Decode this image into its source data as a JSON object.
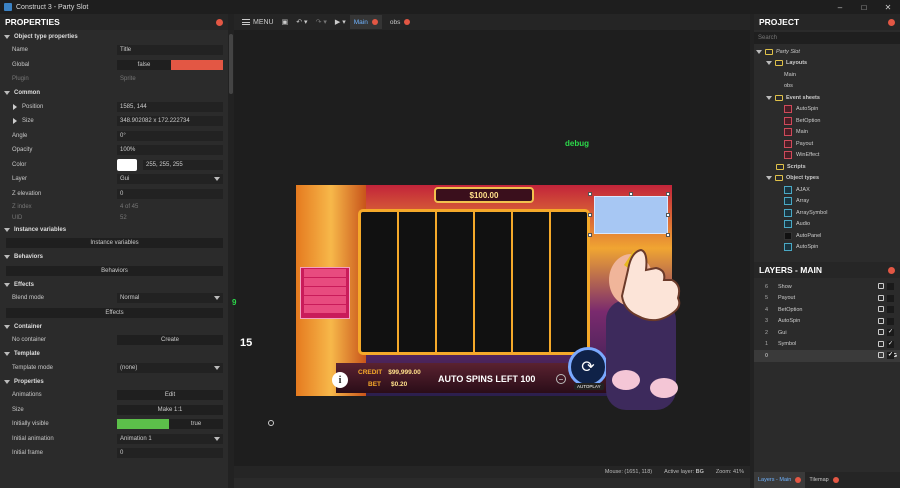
{
  "window": {
    "title": "Construct 3 - Party Slot"
  },
  "properties": {
    "title": "PROPERTIES",
    "sections": {
      "object_type": "Object type properties",
      "common": "Common",
      "instance_vars": "Instance variables",
      "behaviors": "Behaviors",
      "effects": "Effects",
      "container": "Container",
      "template": "Template",
      "props": "Properties"
    },
    "rows": {
      "name_l": "Name",
      "name_v": "Title",
      "global_l": "Global",
      "global_v": "false",
      "plugin_l": "Plugin",
      "plugin_v": "Sprite",
      "position_l": "Position",
      "position_v": "1585, 144",
      "size_l": "Size",
      "size_v": "348.902082 x 172.222734",
      "angle_l": "Angle",
      "angle_v": "0°",
      "opacity_l": "Opacity",
      "opacity_v": "100%",
      "color_l": "Color",
      "color_v": "255, 255, 255",
      "layer_l": "Layer",
      "layer_v": "Gui",
      "zelev_l": "Z elevation",
      "zelev_v": "0",
      "zindex_l": "Z index",
      "zindex_v": "4 of 45",
      "uid_l": "UID",
      "uid_v": "52",
      "instvars_btn": "Instance variables",
      "behaviors_btn": "Behaviors",
      "blend_l": "Blend mode",
      "blend_v": "Normal",
      "effects_btn": "Effects",
      "nocont_l": "No container",
      "create_btn": "Create",
      "tmode_l": "Template mode",
      "tmode_v": "(none)",
      "anims_l": "Animations",
      "edit_btn": "Edit",
      "sizep_l": "Size",
      "make11_btn": "Make 1:1",
      "initvis_l": "Initially visible",
      "initvis_v": "true",
      "initanim_l": "Initial animation",
      "initanim_v": "Animation 1",
      "initframe_l": "Initial frame",
      "initframe_v": "0"
    }
  },
  "toolbar": {
    "menu": "MENU",
    "tab_main": "Main",
    "tab_obs": "obs",
    "user": "slotgen"
  },
  "game": {
    "price": "$100.00",
    "credit_label": "CREDIT",
    "credit_value": "$99,999.00",
    "bet_label": "BET",
    "bet_value": "$0.20",
    "auto_spins": "AUTO SPINS LEFT 100",
    "autoplay": "AUTOPLAY",
    "info": "i"
  },
  "overlay": {
    "debug": "debug",
    "nine": "9",
    "fifteen": "15"
  },
  "status": {
    "mouse": "Mouse: (1651, 118)",
    "active_layer_label": "Active layer:",
    "active_layer": "BG",
    "zoom": "Zoom: 41%"
  },
  "project": {
    "title": "PROJECT",
    "search_placeholder": "Search",
    "root": "Party Slot",
    "layouts": "Layouts",
    "layout_items": [
      "Main",
      "obs"
    ],
    "event_sheets": "Event sheets",
    "event_items": [
      "AutoSpin",
      "BetOption",
      "Main",
      "Payout",
      "WinEffect"
    ],
    "scripts": "Scripts",
    "object_types": "Object types",
    "object_items": [
      "AJAX",
      "Array",
      "ArraySymbol",
      "Audio",
      "AutoPanel",
      "AutoSpin"
    ]
  },
  "layers": {
    "title": "LAYERS - MAIN",
    "items": [
      {
        "idx": "6",
        "name": "Show",
        "visible": ""
      },
      {
        "idx": "5",
        "name": "Payout",
        "visible": ""
      },
      {
        "idx": "4",
        "name": "BetOption",
        "visible": ""
      },
      {
        "idx": "3",
        "name": "AutoSpin",
        "visible": ""
      },
      {
        "idx": "2",
        "name": "Gui",
        "visible": "✓"
      },
      {
        "idx": "1",
        "name": "Symbol",
        "visible": "✓"
      },
      {
        "idx": "0",
        "name": "BG",
        "visible": "✓"
      }
    ]
  },
  "bottom_tabs": {
    "layers": "Layers - Main",
    "tilemap": "Tilemap"
  },
  "colors": {
    "accent": "#6fb3ff",
    "red": "#e35744",
    "green": "#2cd94a",
    "global_false": "#e35744",
    "visible_true": "#5cbf4a"
  }
}
